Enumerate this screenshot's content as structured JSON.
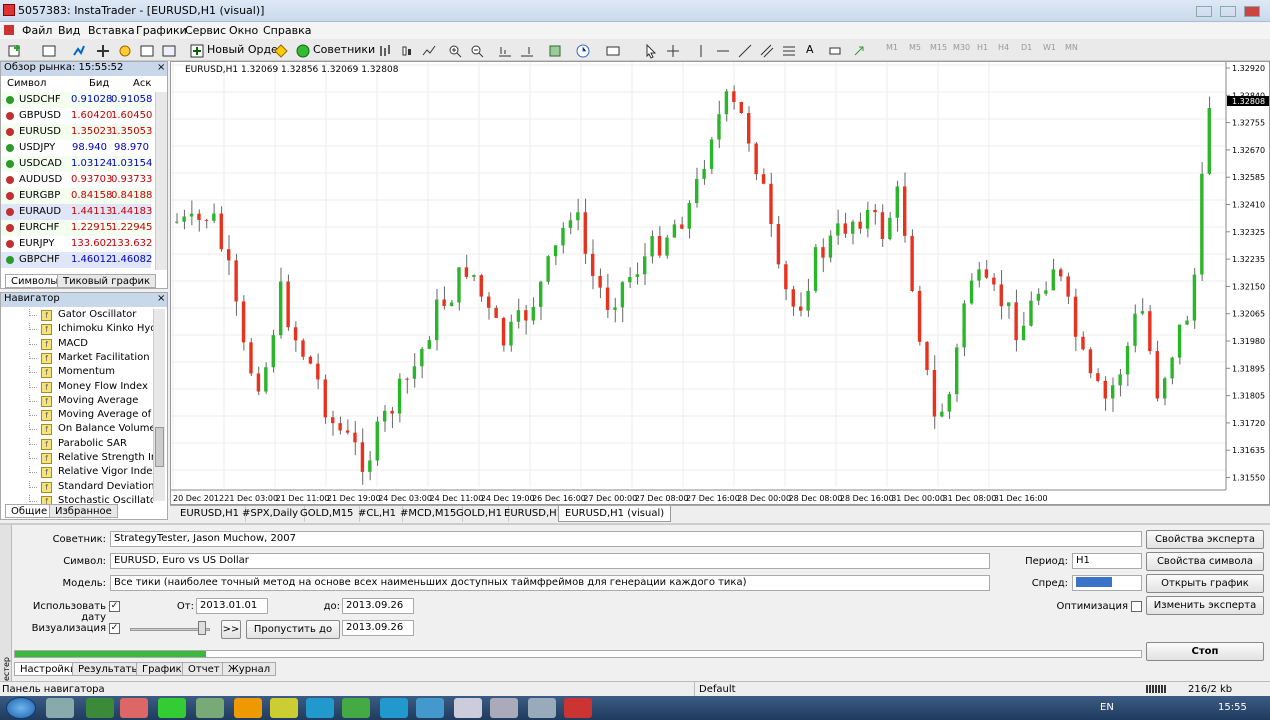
{
  "window": {
    "title": "5057383: InstaTrader - [EURUSD,H1 (visual)]"
  },
  "menu": [
    "Файл",
    "Вид",
    "Вставка",
    "Графики",
    "Сервис",
    "Окно",
    "Справка"
  ],
  "toolbar": {
    "new_order": "Новый Ордер",
    "advisors": "Советники",
    "timeframes": [
      "M1",
      "M5",
      "M15",
      "M30",
      "H1",
      "H4",
      "D1",
      "W1",
      "MN"
    ]
  },
  "market_watch": {
    "title": "Обзор рынка: 15:55:52",
    "col_symbol": "Символ",
    "col_bid": "Бид",
    "col_ask": "Аск",
    "rows": [
      {
        "symbol": "USDCHF",
        "bid": "0.91028",
        "ask": "0.91058",
        "dir": "up"
      },
      {
        "symbol": "GBPUSD",
        "bid": "1.60420",
        "ask": "1.60450",
        "dir": "down"
      },
      {
        "symbol": "EURUSD",
        "bid": "1.35023",
        "ask": "1.35053",
        "dir": "down"
      },
      {
        "symbol": "USDJPY",
        "bid": "98.940",
        "ask": "98.970",
        "dir": "up"
      },
      {
        "symbol": "USDCAD",
        "bid": "1.03124",
        "ask": "1.03154",
        "dir": "up"
      },
      {
        "symbol": "AUDUSD",
        "bid": "0.93703",
        "ask": "0.93733",
        "dir": "down"
      },
      {
        "symbol": "EURGBP",
        "bid": "0.84158",
        "ask": "0.84188",
        "dir": "down"
      },
      {
        "symbol": "EURAUD",
        "bid": "1.44113",
        "ask": "1.44183",
        "dir": "down"
      },
      {
        "symbol": "EURCHF",
        "bid": "1.22915",
        "ask": "1.22945",
        "dir": "down"
      },
      {
        "symbol": "EURJPY",
        "bid": "133.602",
        "ask": "133.632",
        "dir": "down"
      },
      {
        "symbol": "GBPCHF",
        "bid": "1.46012",
        "ask": "1.46082",
        "dir": "up"
      }
    ],
    "tabs": [
      "Символы",
      "Тиковый график"
    ]
  },
  "navigator": {
    "title": "Навигатор",
    "items": [
      "Gator Oscillator",
      "Ichimoku Kinko Hyo",
      "MACD",
      "Market Facilitation Index",
      "Momentum",
      "Money Flow Index",
      "Moving Average",
      "Moving Average of Oscillator",
      "On Balance Volume",
      "Parabolic SAR",
      "Relative Strength Index",
      "Relative Vigor Index",
      "Standard Deviation",
      "Stochastic Oscillator"
    ],
    "tabs": [
      "Общие",
      "Избранное"
    ]
  },
  "chart": {
    "header": "EURUSD,H1  1.32069 1.32856 1.32069 1.32808",
    "last_price": "1.32808",
    "price_labels": [
      "1.32920",
      "1.32840",
      "1.32755",
      "1.32670",
      "1.32585",
      "1.32410",
      "1.32325",
      "1.32235",
      "1.32150",
      "1.32065",
      "1.31980",
      "1.31895",
      "1.31805",
      "1.31720",
      "1.31635",
      "1.31550"
    ],
    "time_labels": [
      "20 Dec 2012",
      "21 Dec 03:00",
      "21 Dec 11:00",
      "21 Dec 19:00",
      "24 Dec 03:00",
      "24 Dec 11:00",
      "24 Dec 19:00",
      "26 Dec 16:00",
      "27 Dec 00:00",
      "27 Dec 08:00",
      "27 Dec 16:00",
      "28 Dec 00:00",
      "28 Dec 08:00",
      "28 Dec 16:00",
      "31 Dec 00:00",
      "31 Dec 08:00",
      "31 Dec 16:00"
    ],
    "tabs": [
      "EURUSD,H1",
      "#SPX,Daily",
      "GOLD,M15",
      "#CL,H1",
      "#MCD,M15",
      "GOLD,H1",
      "EURUSD,H1",
      "EURUSD,H1 (visual)"
    ]
  },
  "tester": {
    "expert_label": "Советник:",
    "expert_value": "StrategyTester, Jason Muchow, 2007",
    "symbol_label": "Символ:",
    "symbol_value": "EURUSD, Euro vs US Dollar",
    "model_label": "Модель:",
    "model_value": "Все тики (наиболее точный метод на основе всех наименьших доступных таймфреймов для генерации каждого тика)",
    "use_date_label": "Использовать дату",
    "from_label": "От:",
    "from_value": "2013.01.01",
    "to_label": "до:",
    "to_value": "2013.09.26",
    "visual_label": "Визуализация",
    "skip_button": "Пропустить до",
    "skip_value": "2013.09.26",
    "ff_button": ">>",
    "period_label": "Период:",
    "period_value": "H1",
    "spread_label": "Спред:",
    "optimization_label": "Оптимизация",
    "buttons": [
      "Свойства эксперта",
      "Свойства символа",
      "Открыть график",
      "Изменить эксперта"
    ],
    "stop_button": "Стоп",
    "progress": 0.17,
    "side_label": "Тестер",
    "tabs": [
      "Настройки",
      "Результаты",
      "График",
      "Отчет",
      "Журнал"
    ]
  },
  "status": {
    "left": "Панель навигатора",
    "profile": "Default",
    "traffic": "216/2 kb"
  },
  "taskbar": {
    "lang": "EN",
    "time": "15:55"
  }
}
